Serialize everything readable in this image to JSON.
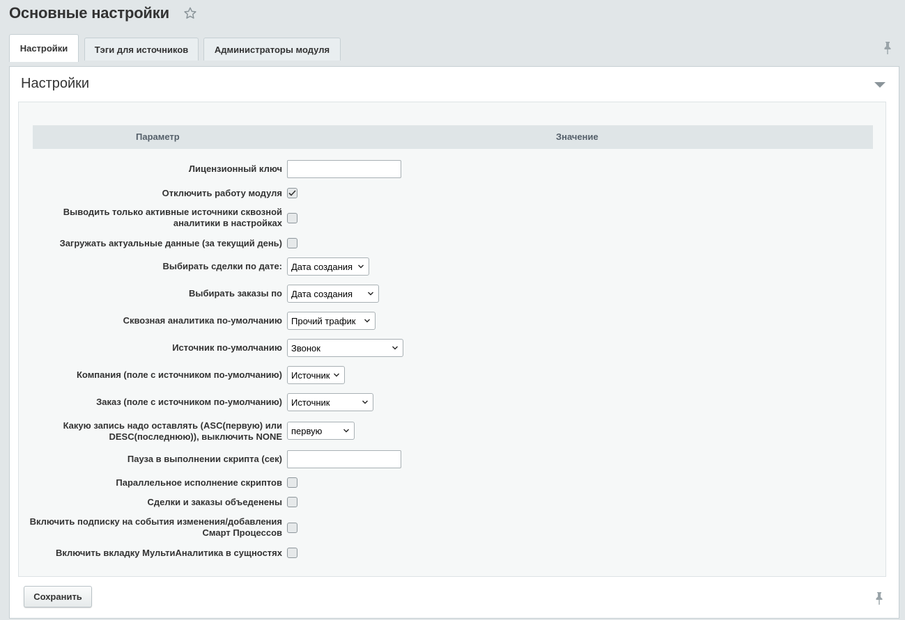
{
  "page": {
    "title": "Основные настройки"
  },
  "tabs": [
    {
      "label": "Настройки"
    },
    {
      "label": "Тэги для источников"
    },
    {
      "label": "Администраторы модуля"
    }
  ],
  "section": {
    "title": "Настройки"
  },
  "table": {
    "header_param": "Параметр",
    "header_value": "Значение"
  },
  "fields": [
    {
      "label": "Лицензионный ключ",
      "type": "text",
      "value": ""
    },
    {
      "label": "Отключить работу модуля",
      "type": "checkbox",
      "checked": true
    },
    {
      "label_line1": "Выводить только активные источники сквозной",
      "label_line2": "аналитики в настройках",
      "type": "checkbox",
      "checked": false
    },
    {
      "label": "Загружать актуальные данные (за текущий день)",
      "type": "checkbox",
      "checked": false
    },
    {
      "label": "Выбирать сделки по дате:",
      "type": "select",
      "value": "Дата создания"
    },
    {
      "label": "Выбирать заказы по",
      "type": "select",
      "value": "Дата создания"
    },
    {
      "label": "Сквозная аналитика по-умолчанию",
      "type": "select",
      "value": "Прочий трафик"
    },
    {
      "label": "Источник по-умолчанию",
      "type": "select",
      "value": "Звонок"
    },
    {
      "label": "Компания (поле с источником по-умолчанию)",
      "type": "select",
      "value": "Источник"
    },
    {
      "label": "Заказ (поле с источником по-умолчанию)",
      "type": "select",
      "value": "Источник"
    },
    {
      "label_line1": "Какую запись надо оставлять (ASC(первую) или",
      "label_line2": "DESC(последнюю)), выключить NONE",
      "type": "select",
      "value": "первую"
    },
    {
      "label": "Пауза в выполнении скрипта (сек)",
      "type": "text",
      "value": ""
    },
    {
      "label": "Параллельное исполнение скриптов",
      "type": "checkbox",
      "checked": false
    },
    {
      "label": "Сделки и заказы объеденены",
      "type": "checkbox",
      "checked": false
    },
    {
      "label_line1": "Включить подписку на события изменения/добавления",
      "label_line2": "Смарт Процессов",
      "type": "checkbox",
      "checked": false
    },
    {
      "label": "Включить вкладку МультиАналитика в сущностях",
      "type": "checkbox",
      "checked": false
    }
  ],
  "footer": {
    "save_label": "Сохранить"
  },
  "icons": {
    "star": "star-outline-icon",
    "pin": "pin-icon",
    "collapse": "triangle-down-icon",
    "chevron": "chevron-down-icon"
  },
  "colors": {
    "background": "#e1e6e8",
    "panel": "#ffffff",
    "inner": "#f6f8f8",
    "header_row": "#dfe5e7"
  }
}
